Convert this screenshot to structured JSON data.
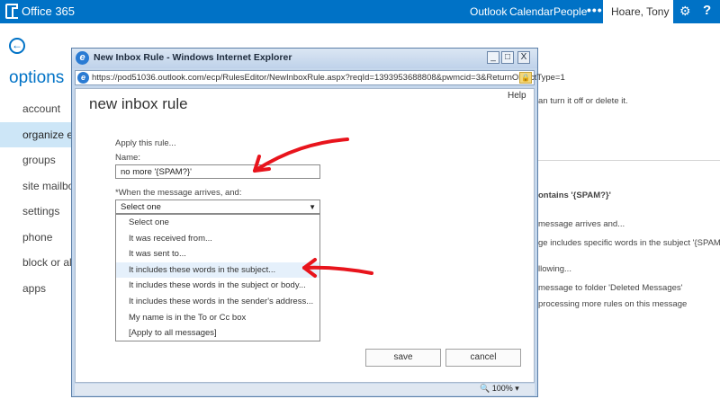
{
  "topbar": {
    "app_title": "Office 365",
    "nav": [
      "Outlook",
      "Calendar",
      "People"
    ],
    "more": "•••",
    "user": "Hoare, Tony",
    "settings_icon": "gear-icon",
    "help_label": "?"
  },
  "options": {
    "back_icon": "←",
    "title": "options",
    "nav": [
      "account",
      "organize em",
      "groups",
      "site mailbox",
      "settings",
      "phone",
      "block or allo",
      "apps"
    ],
    "selected": "organize em"
  },
  "background": {
    "text1": "an turn it off or delete it.",
    "text2": "ontains '{SPAM?}'",
    "text3": "message arrives and...",
    "text4": "ge includes specific words in the subject '{SPAM?}'",
    "text5": "llowing...",
    "text6": "message to folder 'Deleted Messages'",
    "text7": "processing more rules on this message"
  },
  "ie_window": {
    "title": "New Inbox Rule - Windows Internet Explorer",
    "minimize": "_",
    "maximize": "□",
    "close": "X",
    "url": "https://pod51036.outlook.com/ecp/RulesEditor/NewInboxRule.aspx?reqId=1393953688808&pwmcid=3&ReturnObjectType=1",
    "zoom": "100%"
  },
  "dialog": {
    "title": "new inbox rule",
    "help": "Help",
    "apply_label": "Apply this rule...",
    "name_label": "Name:",
    "name_value": "no more '{SPAM?}'",
    "when_label": "*When the message arrives, and:",
    "select_value": "Select one",
    "options": [
      "Select one",
      "It was received from...",
      "It was sent to...",
      "It includes these words in the subject...",
      "It includes these words in the subject or body...",
      "It includes these words in the sender's address...",
      "My name is in the To or Cc box",
      "[Apply to all messages]"
    ],
    "highlighted_option": "It includes these words in the subject...",
    "save": "save",
    "cancel": "cancel"
  },
  "colors": {
    "brand": "#0072c6",
    "annotation_arrow": "#e8141c"
  }
}
